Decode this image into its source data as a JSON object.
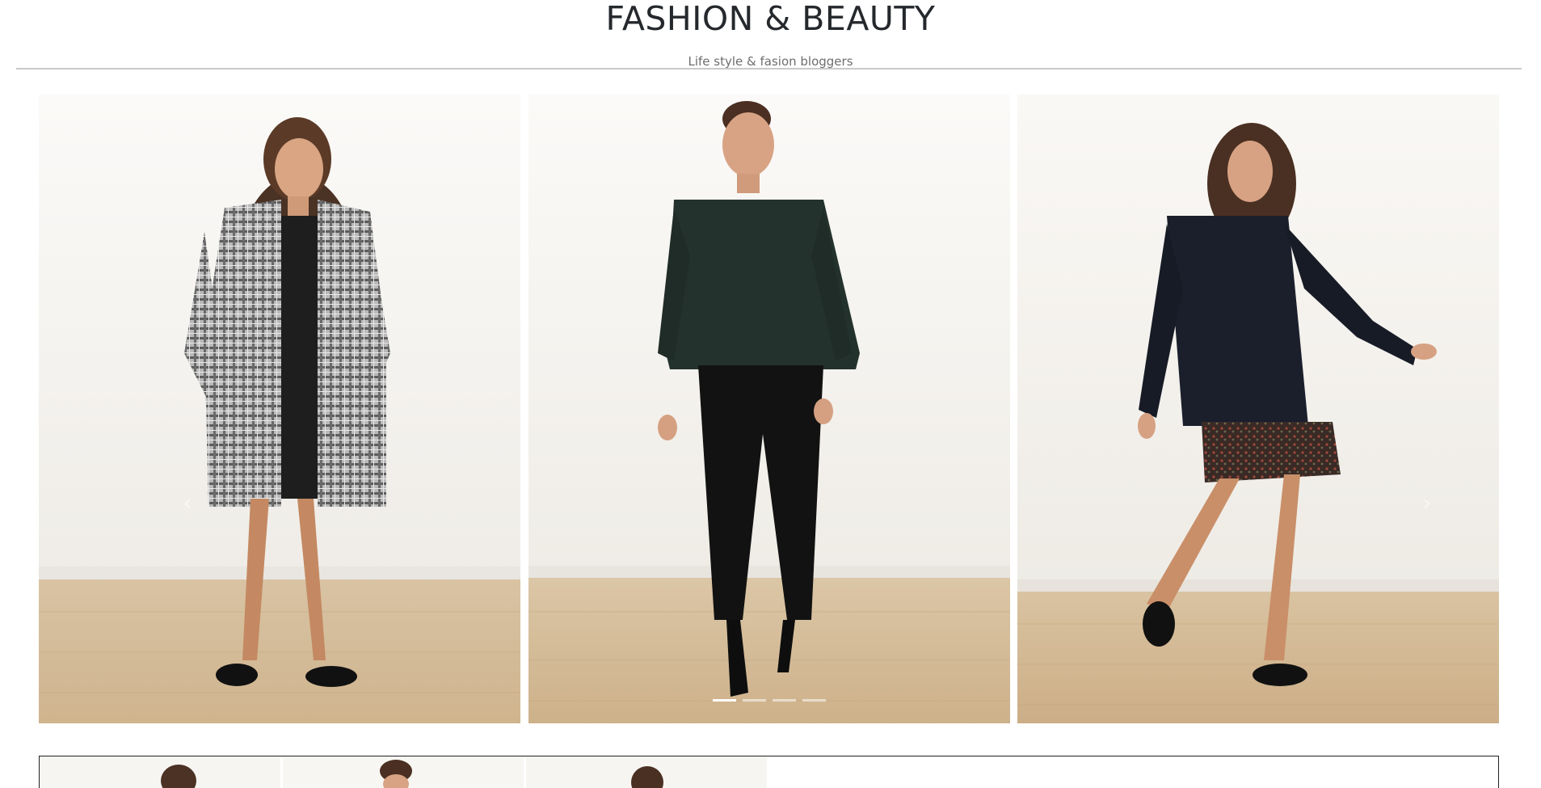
{
  "header": {
    "title": "FASHION & BEAUTY",
    "subtitle": "Life style & fasion bloggers"
  },
  "carousel": {
    "prev_icon": "chevron-left-icon",
    "next_icon": "chevron-right-icon",
    "prev_glyph": "‹",
    "next_glyph": "›",
    "slide_count": 4,
    "active_index": 0,
    "slides": [
      {
        "outfit": "checked coat, black dress",
        "coat_color": "#9a9a9a"
      },
      {
        "outfit": "green sweater, black trousers",
        "coat_color": "#24322d"
      },
      {
        "outfit": "navy peacoat, floral skirt",
        "coat_color": "#1b1f2c"
      }
    ]
  },
  "colors": {
    "wall": "#f6f4f1",
    "floor": "#d7bf9d",
    "title": "#25282c",
    "subtitle": "#6e6e6e"
  }
}
